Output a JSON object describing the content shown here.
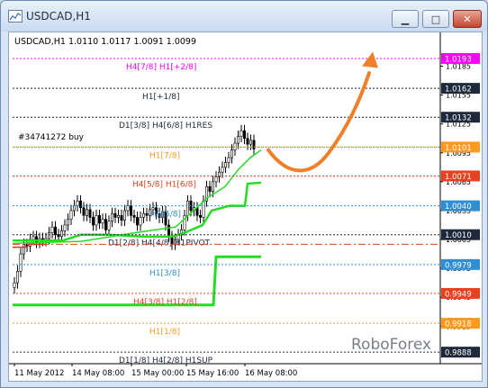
{
  "window": {
    "title": "USDCAD,H1",
    "icon": "chart-window-icon",
    "buttons": [
      {
        "name": "minimize-icon",
        "label": "▁"
      },
      {
        "name": "maximize-icon",
        "label": "□"
      },
      {
        "name": "close-icon",
        "label": "✕"
      }
    ]
  },
  "chart_info": {
    "symbol_line": "USDCAD,H1  1.0110 1.0117 1.0091 1.0099",
    "order_label": "#34741272 buy",
    "watermark": "RoboForex"
  },
  "chart_data": {
    "type": "line",
    "symbol": "USDCAD",
    "timeframe": "H1",
    "ohlc": {
      "open": 1.011,
      "high": 1.0117,
      "low": 1.0091,
      "close": 1.0099
    },
    "ylim": [
      1.088,
      1.02
    ],
    "y_axis": {
      "ticks": [
        "1.0185",
        "1.0155",
        "1.0125",
        "1.0095",
        "1.0065",
        "1.0035",
        "1.0005",
        "0.9975",
        "0.9945",
        "0.9915"
      ],
      "tick_values": [
        1.0185,
        1.0155,
        1.0125,
        1.0095,
        1.0065,
        1.0035,
        1.0005,
        0.9975,
        0.9945,
        0.9915
      ]
    },
    "price_badges": [
      {
        "label": "1.0193",
        "value": 1.0193,
        "color": "#ff00ff"
      },
      {
        "label": "1.0162",
        "value": 1.0162,
        "color": "#1e2a3c"
      },
      {
        "label": "1.0132",
        "value": 1.0132,
        "color": "#1e2a3c"
      },
      {
        "label": "1.0101",
        "value": 1.0101,
        "color": "#ff9a1f"
      },
      {
        "label": "1.0071",
        "value": 1.0071,
        "color": "#e8411f"
      },
      {
        "label": "1.0040",
        "value": 1.004,
        "color": "#2f8fd6"
      },
      {
        "label": "1.0010",
        "value": 1.001,
        "color": "#1e2a3c"
      },
      {
        "label": "0.9979",
        "value": 0.9979,
        "color": "#2f8fd6"
      },
      {
        "label": "0.9949",
        "value": 0.9949,
        "color": "#e8411f"
      },
      {
        "label": "0.9918",
        "value": 0.9918,
        "color": "#ff9a1f"
      },
      {
        "label": "0.9888",
        "value": 0.9888,
        "color": "#1e2a3c"
      }
    ],
    "murrey_levels": [
      {
        "label": "H4[7/8] H1[+2/8]",
        "value": 1.0193,
        "color": "#ff00ff"
      },
      {
        "label": "H1[+1/8]",
        "value": 1.0162,
        "color": "#1e2a3c"
      },
      {
        "label": "D1[3/8] H4[6/8] H1RES",
        "value": 1.0132,
        "color": "#1e2a3c"
      },
      {
        "label": "H1[7/8]",
        "value": 1.0101,
        "color": "#ff9a1f"
      },
      {
        "label": "H4[5/8] H1[6/8]",
        "value": 1.0071,
        "color": "#e8411f"
      },
      {
        "label": "H1[5/8]",
        "value": 1.004,
        "color": "#2f8fd6"
      },
      {
        "label": "D1[2/8] H4[4/8] H1PIVOT",
        "value": 1.001,
        "color": "#1e2a3c"
      },
      {
        "label": "H1[3/8]",
        "value": 0.9979,
        "color": "#2f8fd6"
      },
      {
        "label": "H4[3/8] H1[2/8]",
        "value": 0.9949,
        "color": "#e8411f"
      },
      {
        "label": "H1[1/8]",
        "value": 0.9918,
        "color": "#ff9a1f"
      },
      {
        "label": "D1[1/8] H4[2/8] H1SUP",
        "value": 0.9888,
        "color": "#1e2a3c"
      }
    ],
    "order_level": {
      "label": "#34741272 buy",
      "value": 1.0101
    },
    "stop_level": {
      "value": 1.0,
      "color": "#e8411f"
    },
    "x_axis": {
      "ticks": [
        "11 May 2012",
        "14 May 08:00",
        "15 May 00:00",
        "15 May 16:00",
        "16 May 08:00"
      ]
    },
    "colors": {
      "indicator": "#22dd22",
      "forecast_arrow": "#f07f2a",
      "candles": "#000000"
    }
  }
}
